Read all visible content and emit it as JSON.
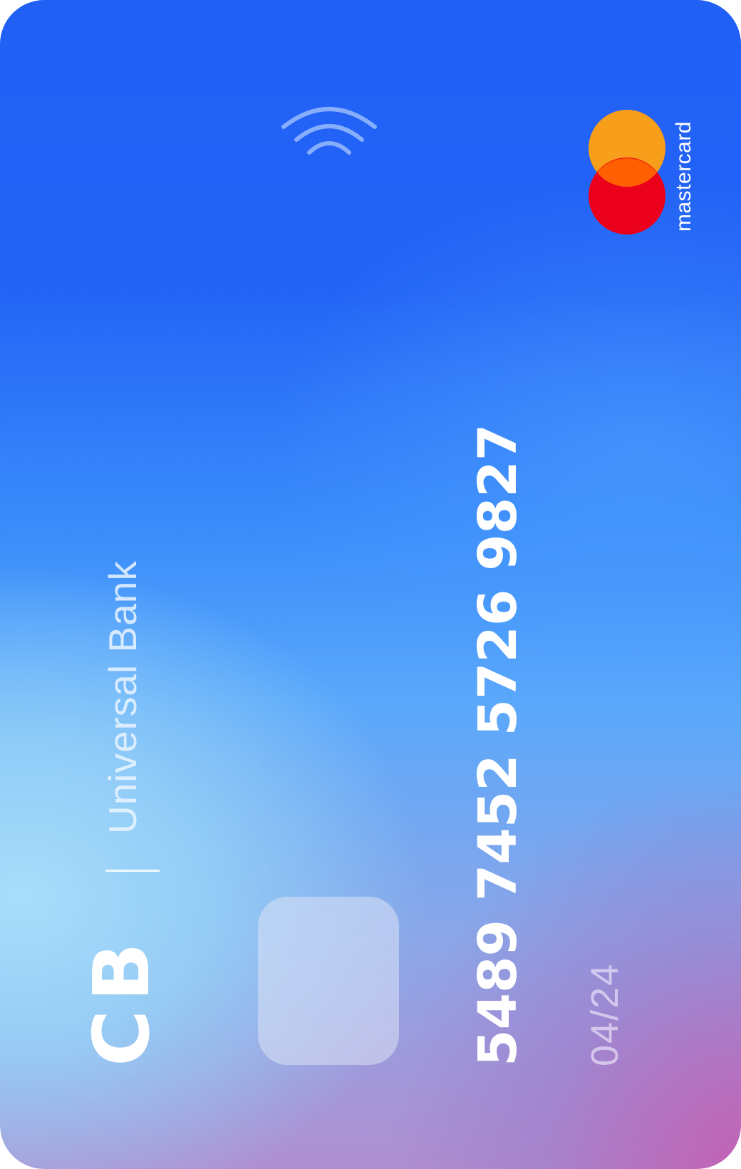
{
  "card": {
    "brand_initials": "CB",
    "bank_name": "Universal Bank",
    "number": "5489 7452 5726 9827",
    "expiry": "04/24",
    "network": "mastercard",
    "contactless_icon": "contactless-icon",
    "chip_icon": "chip-icon"
  },
  "colors": {
    "gradient_top": "#2160f5",
    "gradient_light": "#a8def8",
    "gradient_bottom_right": "#c460b2",
    "mc_orange": "#f79e1b",
    "mc_red": "#eb001b",
    "mc_overlap": "#ff5f00"
  }
}
